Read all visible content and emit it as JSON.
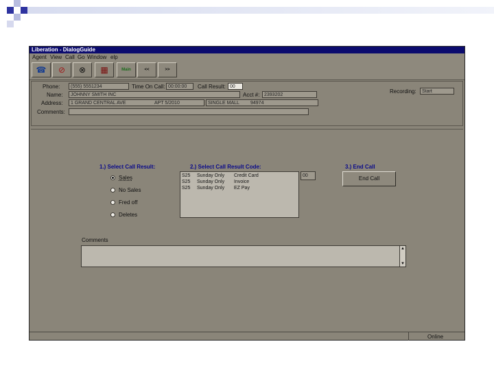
{
  "colors": {
    "title_bar": "#0b0b6e",
    "window_bg": "#8a8579",
    "accent_blue": "#2e33a0",
    "header_text": "#0a0a8a"
  },
  "window": {
    "title": "Liberation - DialogGuide"
  },
  "menu": [
    "Agent",
    "View",
    "Call",
    "Go",
    "Window",
    "elp"
  ],
  "toolbar": {
    "buttons": [
      {
        "name": "phone-icon",
        "glyph": "☎"
      },
      {
        "name": "no-phone-icon",
        "glyph": "⊘"
      },
      {
        "name": "zoom-icon",
        "glyph": "⊗"
      },
      {
        "name": "calendar-icon",
        "glyph": "▦"
      }
    ],
    "text_buttons": [
      "Main",
      "<<",
      ">>"
    ]
  },
  "info": {
    "phone_label": "Phone:",
    "phone_value": "(555) 5551234",
    "time_label": "Time On Call:",
    "time_value": "00:00:00",
    "call_result_label": "Call Result:",
    "call_result_value": "00",
    "name_label": "Name:",
    "name_value": "JOHNNY SMITH INC",
    "acct_label": "Acct #:",
    "acct_value": "2393202",
    "recording_label": "Recording:",
    "recording_value": "Start",
    "address_label": "Address:",
    "address_value": "1 GRAND CENTRAL AVE",
    "apt_value": "APT 5/2010",
    "city_value": "SINGLE MALL",
    "zip_value": "94974",
    "comments_label": "Comments:"
  },
  "step1": {
    "heading": "1.) Select Call Result:",
    "options": [
      "Sales",
      "No Sales",
      "Fred off",
      "Deletes"
    ],
    "selected": 0
  },
  "step2": {
    "heading": "2.) Select Call Result Code:",
    "rows": [
      [
        "S25",
        "Sunday Only",
        "Credit Card"
      ],
      [
        "S25",
        "Sunday Only",
        "Invoice"
      ],
      [
        "S25",
        "Sunday Only",
        "EZ Pay"
      ]
    ],
    "code_value": "00"
  },
  "step3": {
    "heading": "3.) End Call",
    "button": "End Call"
  },
  "comments": {
    "label": "Comments"
  },
  "status": {
    "right": "Online"
  }
}
